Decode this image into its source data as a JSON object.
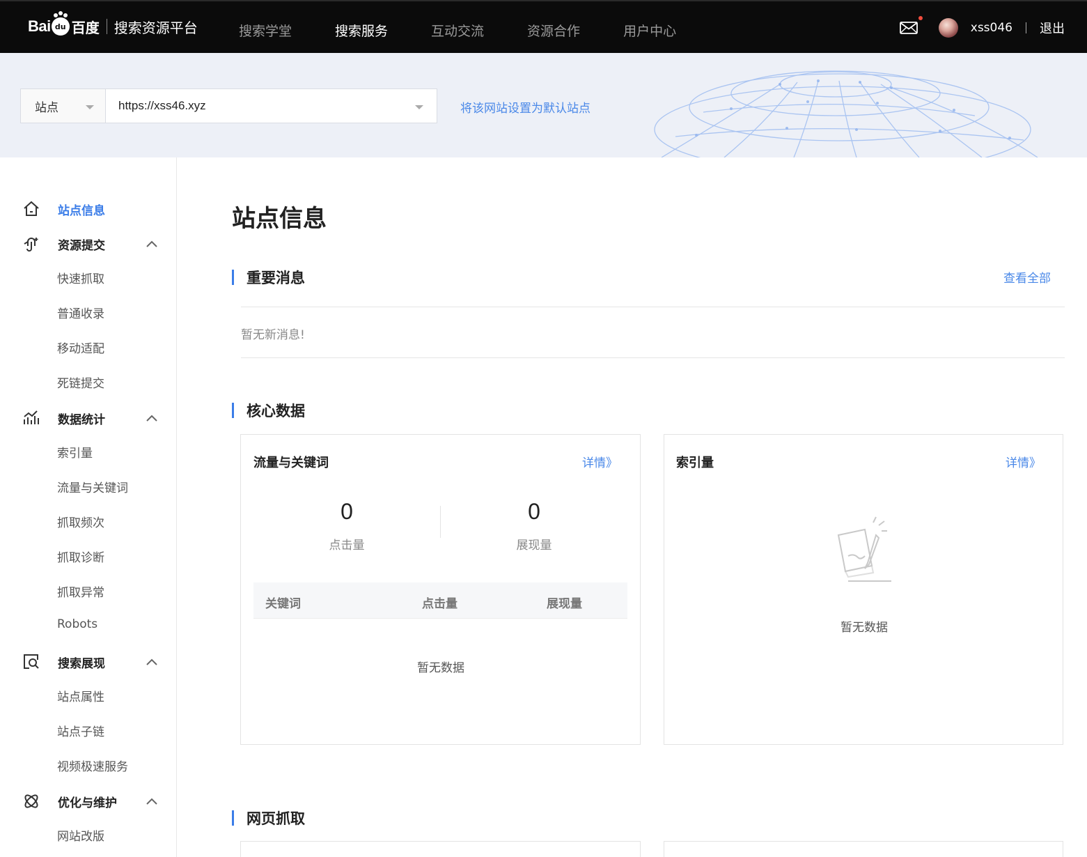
{
  "header": {
    "logo": {
      "bai": "Bai",
      "du": "du",
      "cn": "百度"
    },
    "platform_title": "搜索资源平台",
    "nav": [
      "搜索学堂",
      "搜索服务",
      "互动交流",
      "资源合作",
      "用户中心"
    ],
    "active_nav": "搜索服务",
    "username": "xss046",
    "logout": "退出",
    "mail_has_unread": true
  },
  "site_bar": {
    "type_label": "站点",
    "url": "https://xss46.xyz",
    "set_default_link": "将该网站设置为默认站点"
  },
  "sidebar": {
    "groups": [
      {
        "label": "站点信息",
        "icon": "home-icon",
        "active": true,
        "items": []
      },
      {
        "label": "资源提交",
        "icon": "link-submit-icon",
        "expanded": true,
        "items": [
          "快速抓取",
          "普通收录",
          "移动适配",
          "死链提交"
        ]
      },
      {
        "label": "数据统计",
        "icon": "chart-icon",
        "expanded": true,
        "items": [
          "索引量",
          "流量与关键词",
          "抓取频次",
          "抓取诊断",
          "抓取异常",
          "Robots"
        ]
      },
      {
        "label": "搜索展现",
        "icon": "search-display-icon",
        "expanded": true,
        "items": [
          "站点属性",
          "站点子链",
          "视频极速服务"
        ]
      },
      {
        "label": "优化与维护",
        "icon": "atom-icon",
        "expanded": true,
        "items": [
          "网站改版"
        ]
      }
    ]
  },
  "main": {
    "page_title": "站点信息",
    "messages": {
      "title": "重要消息",
      "view_all": "查看全部",
      "empty": "暂无新消息!"
    },
    "core": {
      "title": "核心数据",
      "traffic_card": {
        "title": "流量与关键词",
        "detail_link": "详情》",
        "clicks_value": "0",
        "clicks_label": "点击量",
        "impressions_value": "0",
        "impressions_label": "展现量",
        "table_headers": [
          "关键词",
          "点击量",
          "展现量"
        ],
        "empty": "暂无数据"
      },
      "index_card": {
        "title": "索引量",
        "detail_link": "详情》",
        "empty": "暂无数据"
      }
    },
    "crawl": {
      "title": "网页抓取"
    }
  },
  "colors": {
    "accent": "#3b7de8",
    "link": "#4a88e8",
    "topbar_bg": "#0b0b0b",
    "banner_bg": "#edf0f7",
    "notify_dot": "#f24c3d"
  }
}
